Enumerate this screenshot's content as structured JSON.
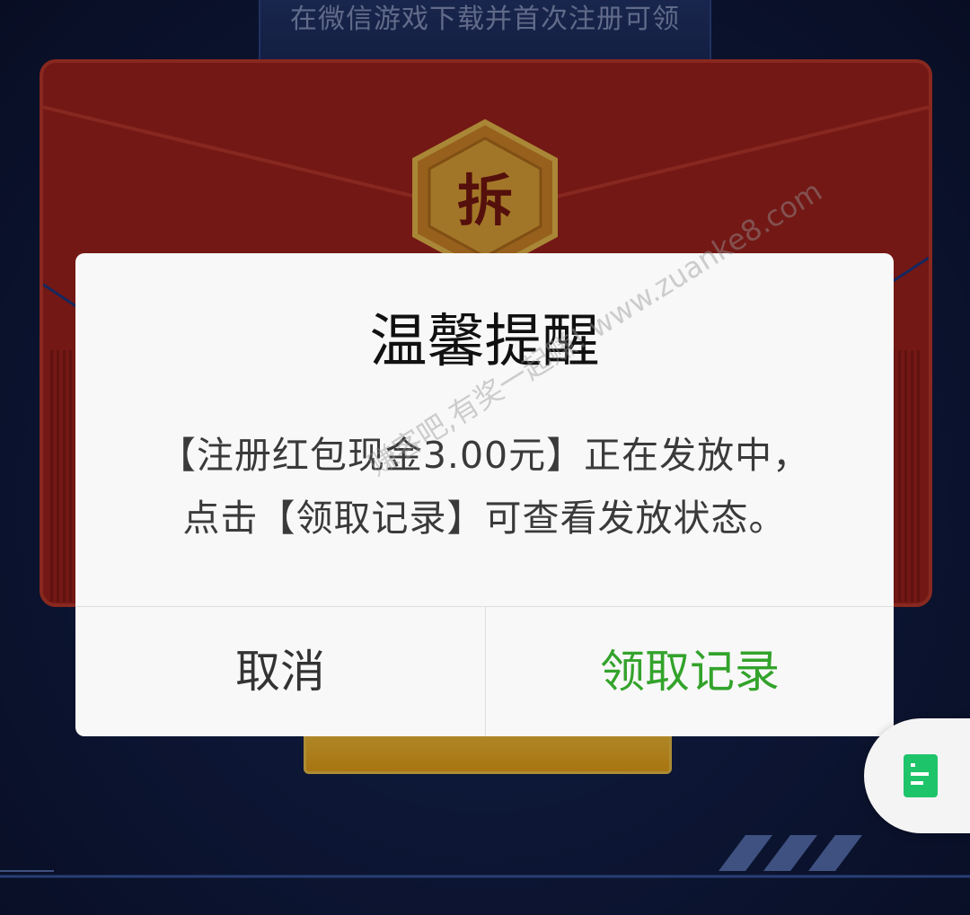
{
  "background": {
    "top_hint": "在微信游戏下载并首次注册可领",
    "open_badge_label": "拆"
  },
  "dialog": {
    "title": "温馨提醒",
    "body_lines": [
      "【注册红包现金3.00元】正在发放中，",
      "点击【领取记录】可查看发放状态。"
    ],
    "cancel_label": "取消",
    "confirm_label": "领取记录"
  },
  "side_tab": {
    "icon": "document-list-icon"
  },
  "watermark": "赚客吧,有奖一起赚! www.zuanke8.com",
  "colors": {
    "confirm_green": "#33a32b",
    "envelope_red": "#a5231f",
    "icon_green": "#1ec46a"
  }
}
